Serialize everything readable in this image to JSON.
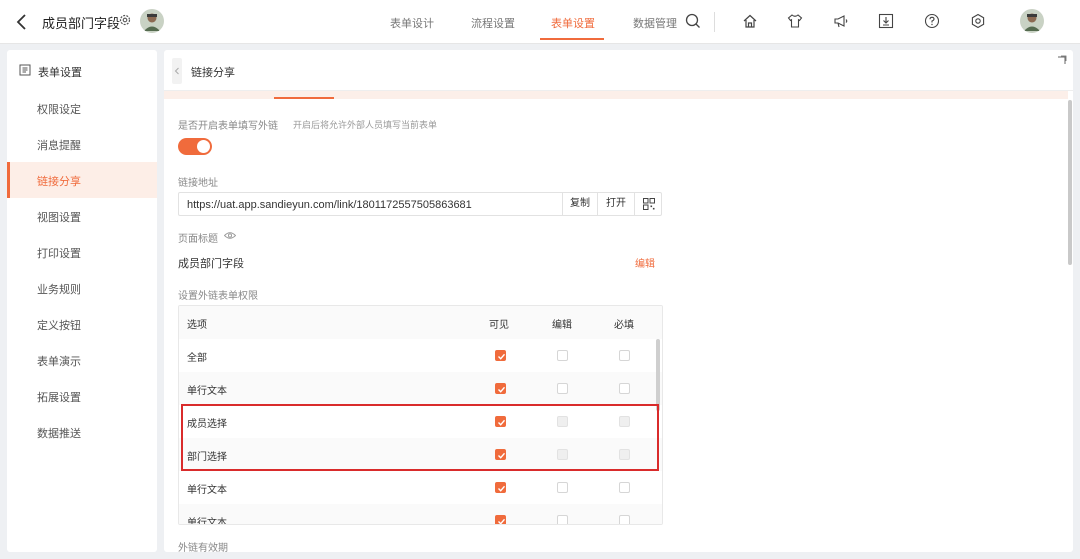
{
  "header": {
    "title": "成员部门字段",
    "tabs": [
      {
        "label": "表单设计"
      },
      {
        "label": "流程设置"
      },
      {
        "label": "表单设置"
      },
      {
        "label": "数据管理"
      }
    ],
    "active_tab": "表单设置",
    "icons": [
      "search-icon",
      "home-icon",
      "shirt-icon",
      "megaphone-icon",
      "download-icon",
      "help-icon",
      "settings-icon"
    ]
  },
  "sidebar": {
    "heading": "表单设置",
    "items": [
      {
        "label": "权限设定"
      },
      {
        "label": "消息提醒"
      },
      {
        "label": "链接分享"
      },
      {
        "label": "视图设置"
      },
      {
        "label": "打印设置"
      },
      {
        "label": "业务规则"
      },
      {
        "label": "定义按钮"
      },
      {
        "label": "表单演示"
      },
      {
        "label": "拓展设置"
      },
      {
        "label": "数据推送"
      }
    ],
    "active_item": "链接分享"
  },
  "main": {
    "title": "链接分享",
    "external_link": {
      "label": "是否开启表单填写外链",
      "hint": "开启后将允许外部人员填写当前表单",
      "enabled": true
    },
    "link_address": {
      "label": "链接地址",
      "url": "https://uat.app.sandieyun.com/link/1801172557505863681",
      "copy_label": "复制",
      "open_label": "打开"
    },
    "page_title": {
      "label": "页面标题",
      "value": "成员部门字段",
      "edit_label": "编辑"
    },
    "permissions": {
      "label": "设置外链表单权限",
      "columns": [
        "选项",
        "可见",
        "编辑",
        "必填"
      ],
      "rows": [
        {
          "name": "全部",
          "visible": true,
          "edit": false,
          "required": false,
          "locked": false
        },
        {
          "name": "单行文本",
          "visible": true,
          "edit": false,
          "required": false,
          "locked": false
        },
        {
          "name": "成员选择",
          "visible": true,
          "edit": false,
          "required": false,
          "locked": true
        },
        {
          "name": "部门选择",
          "visible": true,
          "edit": false,
          "required": false,
          "locked": true
        },
        {
          "name": "单行文本",
          "visible": true,
          "edit": false,
          "required": false,
          "locked": false
        },
        {
          "name": "单行文本",
          "visible": true,
          "edit": false,
          "required": false,
          "locked": false
        }
      ]
    },
    "expiry_label": "外链有效期"
  },
  "colors": {
    "accent": "#f06b3c",
    "highlight": "#d92b2b",
    "active_bg": "#fdeee7"
  }
}
